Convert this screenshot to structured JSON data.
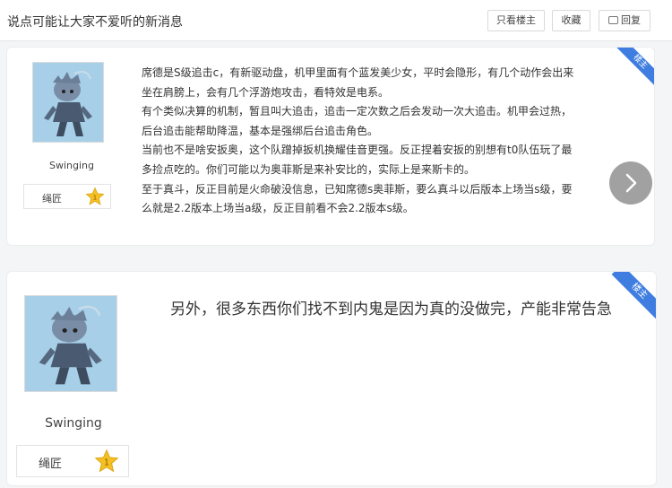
{
  "header": {
    "title": "说点可能让大家不爱听的新消息",
    "only_op_label": "只看楼主",
    "favorite_label": "收藏",
    "reply_label": "回复"
  },
  "posts": [
    {
      "badge": "楼主",
      "author": "Swinging",
      "rank": "绳匠",
      "rank_level": "1",
      "lines": [
        "席德是S级追击c，有新驱动盘，机甲里面有个蓝发美少女，平时会隐形，有几个动作会出来",
        "坐在肩膀上，会有几个浮游炮攻击，看特效是电系。",
        "有个类似决算的机制，暂且叫大追击，追击一定次数之后会发动一次大追击。机甲会过热，",
        "后台追击能帮助降温，基本是强绑后台追击角色。",
        "当前也不是啥安扳奥，这个队蹭掉扳机换耀佳音更强。反正捏着安扳的别想有t0队伍玩了最",
        "多捡点吃的。你们可能以为奥菲斯是来补安比的，实际上是来斯卡的。",
        "至于真斗，反正目前是火命破没信息，已知席德s奥菲斯，要么真斗以后版本上场当s级，要",
        "么就是2.2版本上场当a级，反正目前看不会2.2版本s级。"
      ]
    },
    {
      "badge": "楼主",
      "author": "Swinging",
      "rank": "绳匠",
      "rank_level": "1",
      "text": "另外，很多东西你们找不到内鬼是因为真的没做完，产能非常告急"
    }
  ],
  "icons": {
    "reply": "comment-icon",
    "star": "star-icon",
    "next": "chevron-right-icon"
  },
  "colors": {
    "badge": "#3f7ee0",
    "star": "#f5c023",
    "avatar_bg": "#a7cfe8"
  }
}
